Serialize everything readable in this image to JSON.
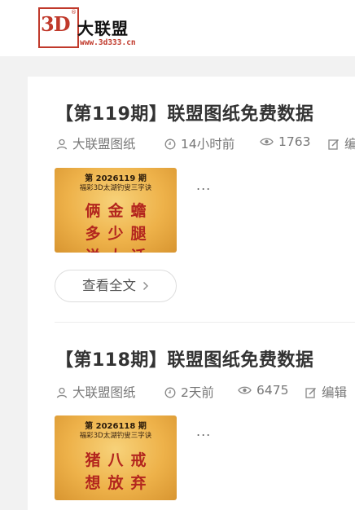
{
  "header": {
    "logo_mark": "3D",
    "logo_reg": "®",
    "logo_name": "大联盟",
    "logo_url": "www.3d333.cn"
  },
  "posts": [
    {
      "title": "【第119期】联盟图纸免费数据",
      "author": "大联盟图纸",
      "time": "14小时前",
      "views": "1763",
      "edit_label": "编",
      "thumb": {
        "issue": "第 2026119 期",
        "subtitle": "福彩3D太湖钓叟三字诀",
        "line1": "俩金蟾",
        "line2": "多少腿",
        "line3": "说大话"
      },
      "excerpt": "...",
      "read_more": "查看全文"
    },
    {
      "title": "【第118期】联盟图纸免费数据",
      "author": "大联盟图纸",
      "time": "2天前",
      "views": "6475",
      "edit_label": "编辑",
      "thumb": {
        "issue": "第 2026118 期",
        "subtitle": "福彩3D太湖钓叟三字诀",
        "line1": "猪八戒",
        "line2": "想放弃"
      },
      "excerpt": "..."
    }
  ],
  "icons": {
    "author": "user-icon",
    "time": "clock-icon",
    "views": "eye-icon",
    "edit": "edit-icon",
    "read_more": "chevron-right-icon"
  },
  "colors": {
    "brand_red": "#c0392b",
    "thumb_gold": "#eeb24a",
    "thumb_text_red": "#b3261e",
    "page_bg": "#f2f2f2"
  }
}
